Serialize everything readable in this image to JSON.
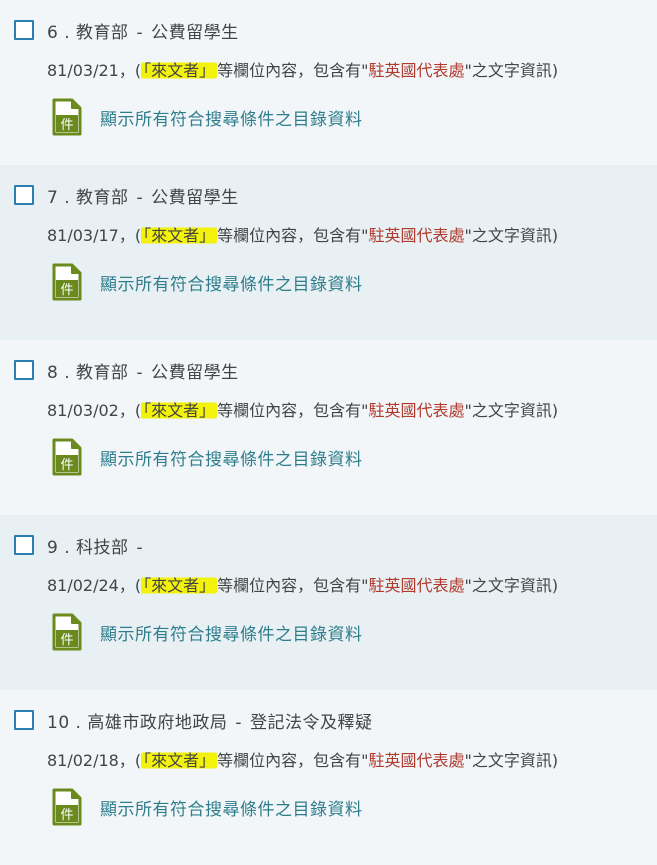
{
  "records": [
    {
      "title": "6 . 教育部",
      "separator": "-",
      "subtitle": "公費留學生",
      "date": "81/03/21",
      "desc_pre": "，(",
      "field": "「來文者」",
      "desc_mid": "等欄位內容，包含有\"",
      "keyword": "駐英國代表處",
      "desc_post": "\"之文字資訊)",
      "link_label": "顯示所有符合搜尋條件之目錄資料",
      "icon_char": "件"
    },
    {
      "title": "7 . 教育部",
      "separator": "-",
      "subtitle": "公費留學生",
      "date": "81/03/17",
      "desc_pre": "，(",
      "field": "「來文者」",
      "desc_mid": "等欄位內容，包含有\"",
      "keyword": "駐英國代表處",
      "desc_post": "\"之文字資訊)",
      "link_label": "顯示所有符合搜尋條件之目錄資料",
      "icon_char": "件"
    },
    {
      "title": "8 . 教育部",
      "separator": "-",
      "subtitle": "公費留學生",
      "date": "81/03/02",
      "desc_pre": "，(",
      "field": "「來文者」",
      "desc_mid": "等欄位內容，包含有\"",
      "keyword": "駐英國代表處",
      "desc_post": "\"之文字資訊)",
      "link_label": "顯示所有符合搜尋條件之目錄資料",
      "icon_char": "件"
    },
    {
      "title": "9 . 科技部",
      "separator": "-",
      "subtitle": "",
      "date": "81/02/24",
      "desc_pre": "，(",
      "field": "「來文者」",
      "desc_mid": "等欄位內容，包含有\"",
      "keyword": "駐英國代表處",
      "desc_post": "\"之文字資訊)",
      "link_label": "顯示所有符合搜尋條件之目錄資料",
      "icon_char": "件"
    },
    {
      "title": "10 . 高雄市政府地政局",
      "separator": "-",
      "subtitle": "登記法令及釋疑",
      "date": "81/02/18",
      "desc_pre": "，(",
      "field": "「來文者」",
      "desc_mid": "等欄位內容，包含有\"",
      "keyword": "駐英國代表處",
      "desc_post": "\"之文字資訊)",
      "link_label": "顯示所有符合搜尋條件之目錄資料",
      "icon_char": "件"
    }
  ],
  "colors": {
    "checkbox_border": "#2a7fb0",
    "highlight": "#f2f20a",
    "keyword": "#b03a2e",
    "link": "#2e7d8c",
    "icon_green": "#6a8a1e",
    "row_bg_a": "#f2f6f9",
    "row_bg_b": "#e9f0f3"
  }
}
